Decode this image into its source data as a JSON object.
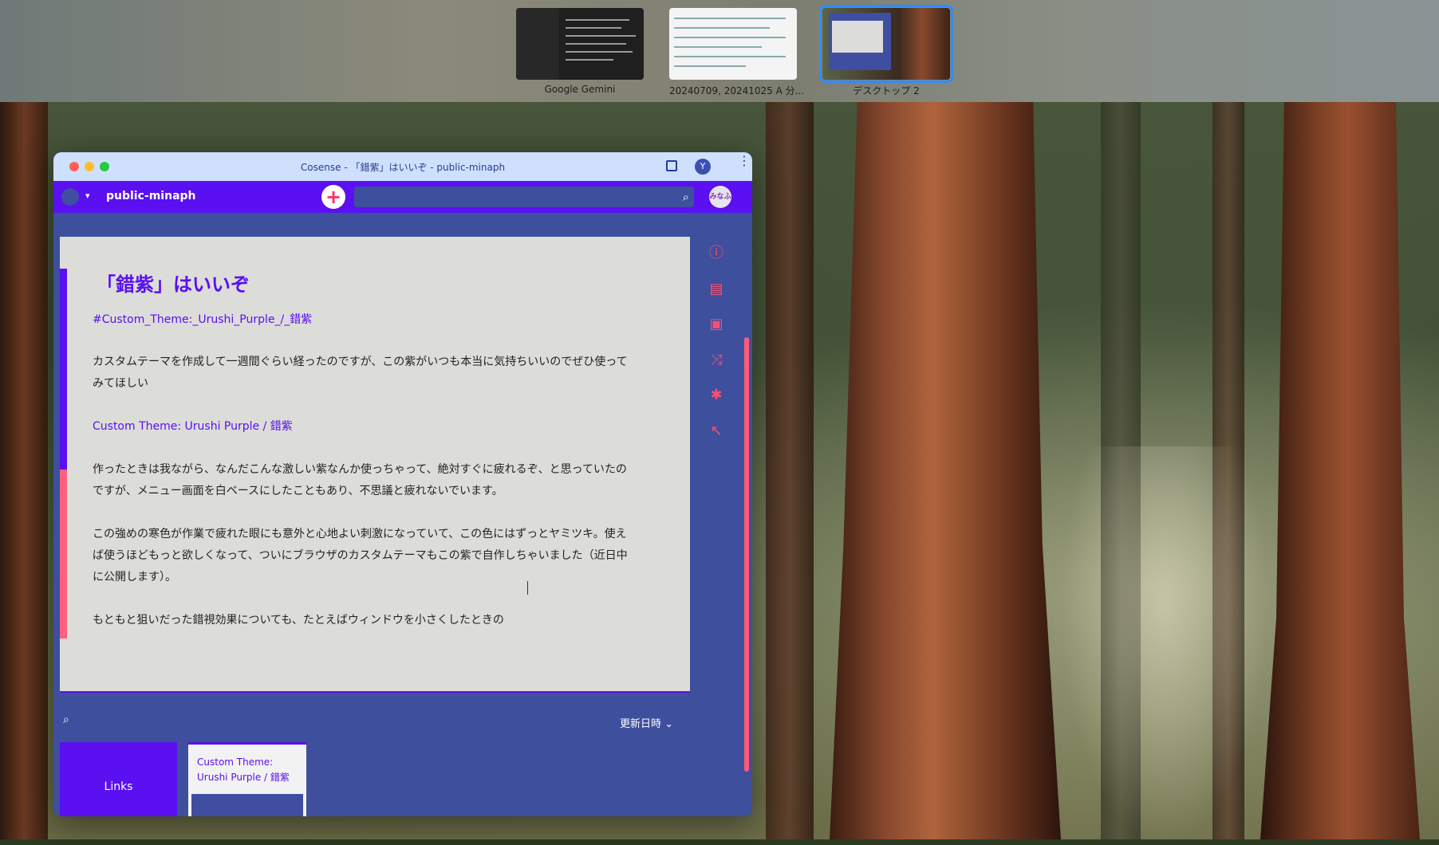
{
  "spaces": [
    {
      "label": "Google Gemini",
      "active": false
    },
    {
      "label": "20240709, 20241025 A 分...",
      "active": false
    },
    {
      "label": "デスクトップ 2",
      "active": true
    }
  ],
  "window": {
    "title": "Cosense - 「錯紫」はいいぞ - public-minaph",
    "profile_initial": "Y"
  },
  "appbar": {
    "project_name": "public-minaph",
    "new_page_label": "+",
    "search_placeholder": "",
    "user_avatar_text": "みなふ"
  },
  "page": {
    "title": "「錯紫」はいいぞ",
    "hashtag": "#Custom_Theme:_Urushi_Purple_/_錯紫",
    "para1_line1": "カスタムテーマを作成して一週間ぐらい経ったのですが、この紫がいつも本当に気持ちいいのでぜひ使って",
    "para1_line2": "みてほしい",
    "link": "Custom Theme: Urushi Purple / 錯紫",
    "para2_line1": "作ったときは我ながら、なんだこんな激しい紫なんか使っちゃって、絶対すぐに疲れるぞ、と思っていたの",
    "para2_line2": "ですが、メニュー画面を白ベースにしたこともあり、不思議と疲れないでいます。",
    "para3_line1": "この強めの寒色が作業で疲れた眼にも意外と心地よい刺激になっていて、この色にはずっとヤミツキ。使え",
    "para3_line2": "ば使うほどもっと欲しくなって、ついにブラウザのカスタムテーマもこの紫で自作しちゃいました（近日中",
    "para3_line3": "に公開します）。",
    "para4_line1": "もともと狙いだった錯視効果についても、たとえばウィンドウを小さくしたときの"
  },
  "side_tools": [
    {
      "icon": "info-icon",
      "glyph": "ⓘ"
    },
    {
      "icon": "document-icon",
      "glyph": "▤"
    },
    {
      "icon": "translate-icon",
      "glyph": "▣"
    },
    {
      "icon": "shuffle-icon",
      "glyph": "⤨"
    },
    {
      "icon": "settings-icon",
      "glyph": "✱"
    },
    {
      "icon": "arrow-up-left-icon",
      "glyph": "↖"
    }
  ],
  "list": {
    "sort_label": "更新日時",
    "links_card_label": "Links",
    "related_card_title": "Custom Theme: Urushi Purple / 錯紫"
  },
  "colors": {
    "accent_purple": "#5a10f0",
    "accent_pink": "#ff5f7e",
    "background_navy": "#3e4f9d",
    "page_bg": "#dcddd9"
  }
}
